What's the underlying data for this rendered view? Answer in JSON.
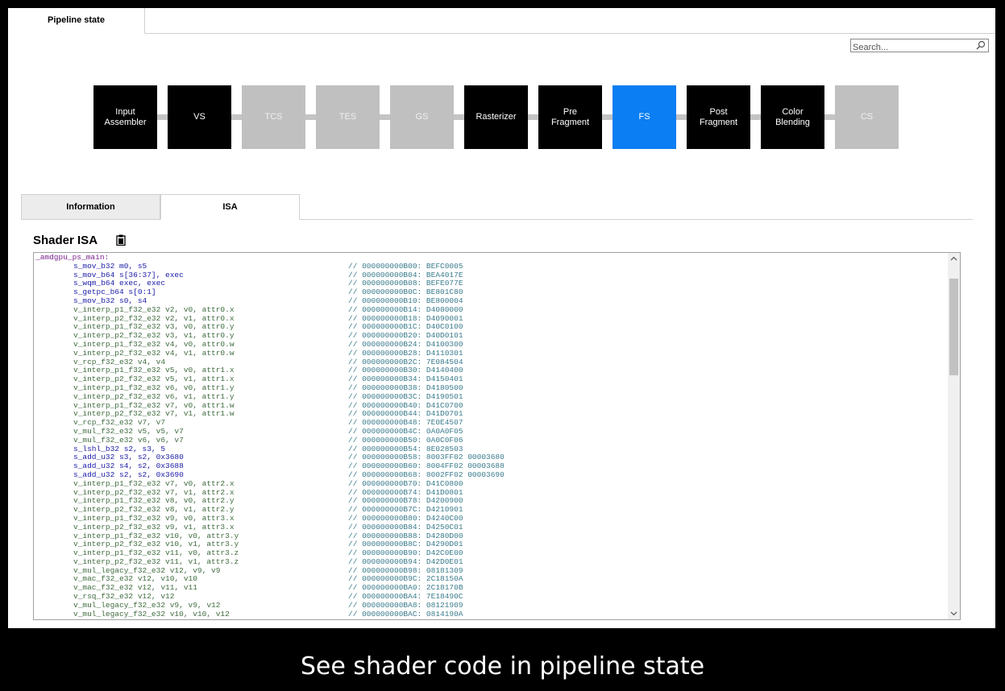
{
  "top_tab": {
    "label": "Pipeline state"
  },
  "search": {
    "placeholder": "Search..."
  },
  "pipeline": {
    "stages": [
      {
        "label": "Input\nAssembler",
        "state": "on"
      },
      {
        "label": "VS",
        "state": "on"
      },
      {
        "label": "TCS",
        "state": "off"
      },
      {
        "label": "TES",
        "state": "off"
      },
      {
        "label": "GS",
        "state": "off"
      },
      {
        "label": "Rasterizer",
        "state": "on"
      },
      {
        "label": "Pre\nFragment",
        "state": "on"
      },
      {
        "label": "FS",
        "state": "active"
      },
      {
        "label": "Post\nFragment",
        "state": "on"
      },
      {
        "label": "Color\nBlending",
        "state": "on"
      },
      {
        "label": "CS",
        "state": "off"
      }
    ],
    "colors": {
      "on": "#000000",
      "off": "#c0c0c0",
      "active": "#0a7ef2"
    }
  },
  "tabs": {
    "information": "Information",
    "isa": "ISA"
  },
  "shader_isa": {
    "title": "Shader ISA",
    "lines": [
      {
        "kind": "label",
        "instr": "_amdgpu_ps_main:",
        "comment": ""
      },
      {
        "kind": "scalar",
        "instr": "s_mov_b32 m0, s5",
        "comment": "// 000000000B00: BEFC0005"
      },
      {
        "kind": "scalar",
        "instr": "s_mov_b64 s[36:37], exec",
        "comment": "// 000000000B04: BEA4017E"
      },
      {
        "kind": "scalar",
        "instr": "s_wqm_b64 exec, exec",
        "comment": "// 000000000B08: BEFE077E"
      },
      {
        "kind": "scalar",
        "instr": "s_getpc_b64 s[0:1]",
        "comment": "// 000000000B0C: BE801C80"
      },
      {
        "kind": "scalar",
        "instr": "s_mov_b32 s0, s4",
        "comment": "// 000000000B10: BE800004"
      },
      {
        "kind": "vector",
        "instr": "v_interp_p1_f32_e32 v2, v0, attr0.x",
        "comment": "// 000000000B14: D4080000"
      },
      {
        "kind": "vector",
        "instr": "v_interp_p2_f32_e32 v2, v1, attr0.x",
        "comment": "// 000000000B18: D4090001"
      },
      {
        "kind": "vector",
        "instr": "v_interp_p1_f32_e32 v3, v0, attr0.y",
        "comment": "// 000000000B1C: D40C0100"
      },
      {
        "kind": "vector",
        "instr": "v_interp_p2_f32_e32 v3, v1, attr0.y",
        "comment": "// 000000000B20: D40D0101"
      },
      {
        "kind": "vector",
        "instr": "v_interp_p1_f32_e32 v4, v0, attr0.w",
        "comment": "// 000000000B24: D4100300"
      },
      {
        "kind": "vector",
        "instr": "v_interp_p2_f32_e32 v4, v1, attr0.w",
        "comment": "// 000000000B28: D4110301"
      },
      {
        "kind": "vector",
        "instr": "v_rcp_f32_e32 v4, v4",
        "comment": "// 000000000B2C: 7E084504"
      },
      {
        "kind": "vector",
        "instr": "v_interp_p1_f32_e32 v5, v0, attr1.x",
        "comment": "// 000000000B30: D4140400"
      },
      {
        "kind": "vector",
        "instr": "v_interp_p2_f32_e32 v5, v1, attr1.x",
        "comment": "// 000000000B34: D4150401"
      },
      {
        "kind": "vector",
        "instr": "v_interp_p1_f32_e32 v6, v0, attr1.y",
        "comment": "// 000000000B38: D4180500"
      },
      {
        "kind": "vector",
        "instr": "v_interp_p2_f32_e32 v6, v1, attr1.y",
        "comment": "// 000000000B3C: D4190501"
      },
      {
        "kind": "vector",
        "instr": "v_interp_p1_f32_e32 v7, v0, attr1.w",
        "comment": "// 000000000B40: D41C0700"
      },
      {
        "kind": "vector",
        "instr": "v_interp_p2_f32_e32 v7, v1, attr1.w",
        "comment": "// 000000000B44: D41D0701"
      },
      {
        "kind": "vector",
        "instr": "v_rcp_f32_e32 v7, v7",
        "comment": "// 000000000B48: 7E0E4507"
      },
      {
        "kind": "vector",
        "instr": "v_mul_f32_e32 v5, v5, v7",
        "comment": "// 000000000B4C: 0A0A0F05"
      },
      {
        "kind": "vector",
        "instr": "v_mul_f32_e32 v6, v6, v7",
        "comment": "// 000000000B50: 0A0C0F06"
      },
      {
        "kind": "scalar",
        "instr": "s_lshl_b32 s2, s3, 5",
        "comment": "// 000000000B54: 8E028503"
      },
      {
        "kind": "scalar",
        "instr": "s_add_u32 s3, s2, 0x3680",
        "comment": "// 000000000B58: 8003FF02 00003680"
      },
      {
        "kind": "scalar",
        "instr": "s_add_u32 s4, s2, 0x3688",
        "comment": "// 000000000B60: 8004FF02 00003688"
      },
      {
        "kind": "scalar",
        "instr": "s_add_u32 s2, s2, 0x3690",
        "comment": "// 000000000B68: 8002FF02 00003690"
      },
      {
        "kind": "vector",
        "instr": "v_interp_p1_f32_e32 v7, v0, attr2.x",
        "comment": "// 000000000B70: D41C0800"
      },
      {
        "kind": "vector",
        "instr": "v_interp_p2_f32_e32 v7, v1, attr2.x",
        "comment": "// 000000000B74: D41D0801"
      },
      {
        "kind": "vector",
        "instr": "v_interp_p1_f32_e32 v8, v0, attr2.y",
        "comment": "// 000000000B78: D4200900"
      },
      {
        "kind": "vector",
        "instr": "v_interp_p2_f32_e32 v8, v1, attr2.y",
        "comment": "// 000000000B7C: D4210901"
      },
      {
        "kind": "vector",
        "instr": "v_interp_p1_f32_e32 v9, v0, attr3.x",
        "comment": "// 000000000B80: D4240C00"
      },
      {
        "kind": "vector",
        "instr": "v_interp_p2_f32_e32 v9, v1, attr3.x",
        "comment": "// 000000000B84: D4250C01"
      },
      {
        "kind": "vector",
        "instr": "v_interp_p1_f32_e32 v10, v0, attr3.y",
        "comment": "// 000000000B88: D4280D00"
      },
      {
        "kind": "vector",
        "instr": "v_interp_p2_f32_e32 v10, v1, attr3.y",
        "comment": "// 000000000B8C: D4290D01"
      },
      {
        "kind": "vector",
        "instr": "v_interp_p1_f32_e32 v11, v0, attr3.z",
        "comment": "// 000000000B90: D42C0E00"
      },
      {
        "kind": "vector",
        "instr": "v_interp_p2_f32_e32 v11, v1, attr3.z",
        "comment": "// 000000000B94: D42D0E01"
      },
      {
        "kind": "vector",
        "instr": "v_mul_legacy_f32_e32 v12, v9, v9",
        "comment": "// 000000000B98: 08181309"
      },
      {
        "kind": "vector",
        "instr": "v_mac_f32_e32 v12, v10, v10",
        "comment": "// 000000000B9C: 2C18150A"
      },
      {
        "kind": "vector",
        "instr": "v_mac_f32_e32 v12, v11, v11",
        "comment": "// 000000000BA0: 2C18170B"
      },
      {
        "kind": "vector",
        "instr": "v_rsq_f32_e32 v12, v12",
        "comment": "// 000000000BA4: 7E18490C"
      },
      {
        "kind": "vector",
        "instr": "v_mul_legacy_f32_e32 v9, v9, v12",
        "comment": "// 000000000BA8: 08121909"
      },
      {
        "kind": "vector",
        "instr": "v_mul_legacy_f32_e32 v10, v10, v12",
        "comment": "// 000000000BAC: 0814190A"
      }
    ]
  },
  "caption": "See shader code in pipeline state"
}
